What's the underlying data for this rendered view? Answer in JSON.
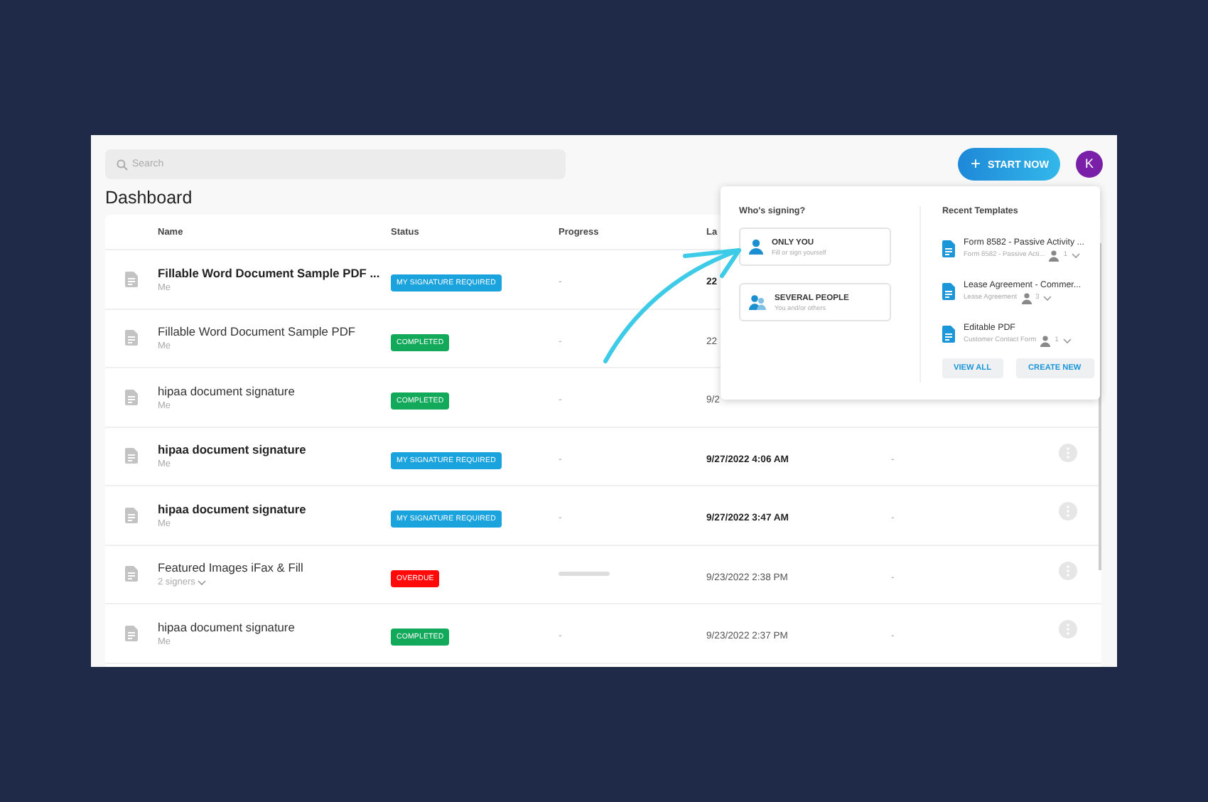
{
  "search": {
    "placeholder": "Search"
  },
  "start_button": {
    "icon": "+",
    "label": "START NOW"
  },
  "avatar": {
    "initial": "K"
  },
  "title": "Dashboard",
  "table": {
    "columns": [
      "Name",
      "Status",
      "Progress",
      "La"
    ],
    "rows": [
      {
        "name": "Fillable Word Document Sample PDF ...",
        "owner": "Me",
        "owner_dropdown": false,
        "unread": true,
        "status": {
          "label": "MY SIGNATURE REQUIRED",
          "color": "#1ba3de"
        },
        "progress": {
          "kind": "text",
          "text": "-"
        },
        "date": "22",
        "menu": false
      },
      {
        "name": "Fillable Word Document Sample PDF",
        "owner": "Me",
        "owner_dropdown": false,
        "unread": false,
        "status": {
          "label": "COMPLETED",
          "color": "#12a95a"
        },
        "progress": {
          "kind": "text",
          "text": "-"
        },
        "date": "22",
        "menu": false
      },
      {
        "name": "hipaa document signature",
        "owner": "Me",
        "owner_dropdown": false,
        "unread": false,
        "status": {
          "label": "COMPLETED",
          "color": "#12a95a"
        },
        "progress": {
          "kind": "text",
          "text": "-"
        },
        "date": "9/2",
        "menu": false
      },
      {
        "name": "hipaa document signature",
        "owner": "Me",
        "owner_dropdown": false,
        "unread": true,
        "status": {
          "label": "MY SIGNATURE REQUIRED",
          "color": "#1ba3de"
        },
        "progress": {
          "kind": "text",
          "text": "-"
        },
        "date": "9/27/2022 4:06 AM",
        "column_5": "-",
        "menu": true
      },
      {
        "name": "hipaa document signature",
        "owner": "Me",
        "owner_dropdown": false,
        "unread": true,
        "status": {
          "label": "MY SIGNATURE REQUIRED",
          "color": "#1ba3de"
        },
        "progress": {
          "kind": "text",
          "text": "-"
        },
        "date": "9/27/2022 3:47 AM",
        "column_5": "-",
        "menu": true
      },
      {
        "name": "Featured Images iFax & Fill",
        "owner": "2 signers",
        "owner_dropdown": true,
        "unread": false,
        "status": {
          "label": "OVERDUE",
          "color": "#ff0a0a"
        },
        "progress": {
          "kind": "bar",
          "level": 0
        },
        "date": "9/23/2022 2:38 PM",
        "column_5": "-",
        "menu": true
      },
      {
        "name": "hipaa document signature",
        "owner": "Me",
        "owner_dropdown": false,
        "unread": false,
        "status": {
          "label": "COMPLETED",
          "color": "#12a95a"
        },
        "progress": {
          "kind": "text",
          "text": "-"
        },
        "date": "9/23/2022 2:37 PM",
        "column_5": "-",
        "menu": true
      }
    ]
  },
  "signing": {
    "title": "Who's signing?",
    "options": [
      {
        "kind": "single",
        "label": "ONLY YOU",
        "hint": "Fill or sign yourself"
      },
      {
        "kind": "group",
        "label": "SEVERAL PEOPLE",
        "hint": "You and/or others"
      }
    ]
  },
  "templates": {
    "title": "Recent Templates",
    "items": [
      {
        "name": "Form 8582 - Passive Activity ...",
        "subtitle": "Form 8582 - Passive Acti...",
        "signers": "1"
      },
      {
        "name": "Lease Agreement - Commer...",
        "subtitle": "Lease Agreement",
        "signers": "3"
      },
      {
        "name": "Editable PDF",
        "subtitle": "Customer Contact Form",
        "signers": "1"
      }
    ],
    "buttons": [
      "VIEW ALL",
      "CREATE NEW"
    ]
  }
}
